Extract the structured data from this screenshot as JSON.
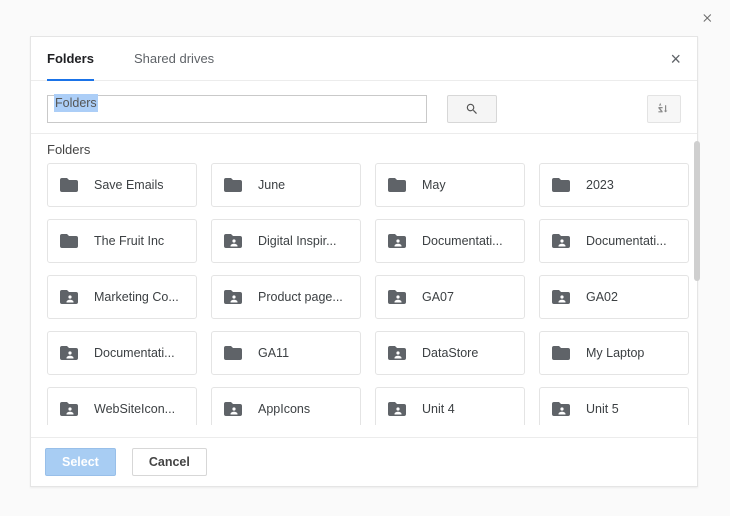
{
  "outer": {
    "close_title": "Close"
  },
  "tabs": {
    "folders": "Folders",
    "shared": "Shared drives",
    "active": "folders"
  },
  "search": {
    "value": "Folders",
    "highlighted": true,
    "button_title": "Search",
    "sort_title": "Sort A-Z"
  },
  "section_label": "Folders",
  "folders": [
    {
      "label": "Save Emails",
      "shared": false
    },
    {
      "label": "June",
      "shared": false
    },
    {
      "label": "May",
      "shared": false
    },
    {
      "label": "2023",
      "shared": false
    },
    {
      "label": "The Fruit Inc",
      "shared": false
    },
    {
      "label": "Digital Inspir...",
      "shared": true
    },
    {
      "label": "Documentati...",
      "shared": true
    },
    {
      "label": "Documentati...",
      "shared": true
    },
    {
      "label": "Marketing Co...",
      "shared": true
    },
    {
      "label": "Product page...",
      "shared": true
    },
    {
      "label": "GA07",
      "shared": true
    },
    {
      "label": "GA02",
      "shared": true
    },
    {
      "label": "Documentati...",
      "shared": true
    },
    {
      "label": "GA11",
      "shared": false
    },
    {
      "label": "DataStore",
      "shared": true
    },
    {
      "label": "My Laptop",
      "shared": false
    },
    {
      "label": "WebSiteIcon...",
      "shared": true
    },
    {
      "label": "AppIcons",
      "shared": true
    },
    {
      "label": "Unit 4",
      "shared": true
    },
    {
      "label": "Unit 5",
      "shared": true
    }
  ],
  "footer": {
    "select": "Select",
    "cancel": "Cancel"
  },
  "dialog_close": "×"
}
